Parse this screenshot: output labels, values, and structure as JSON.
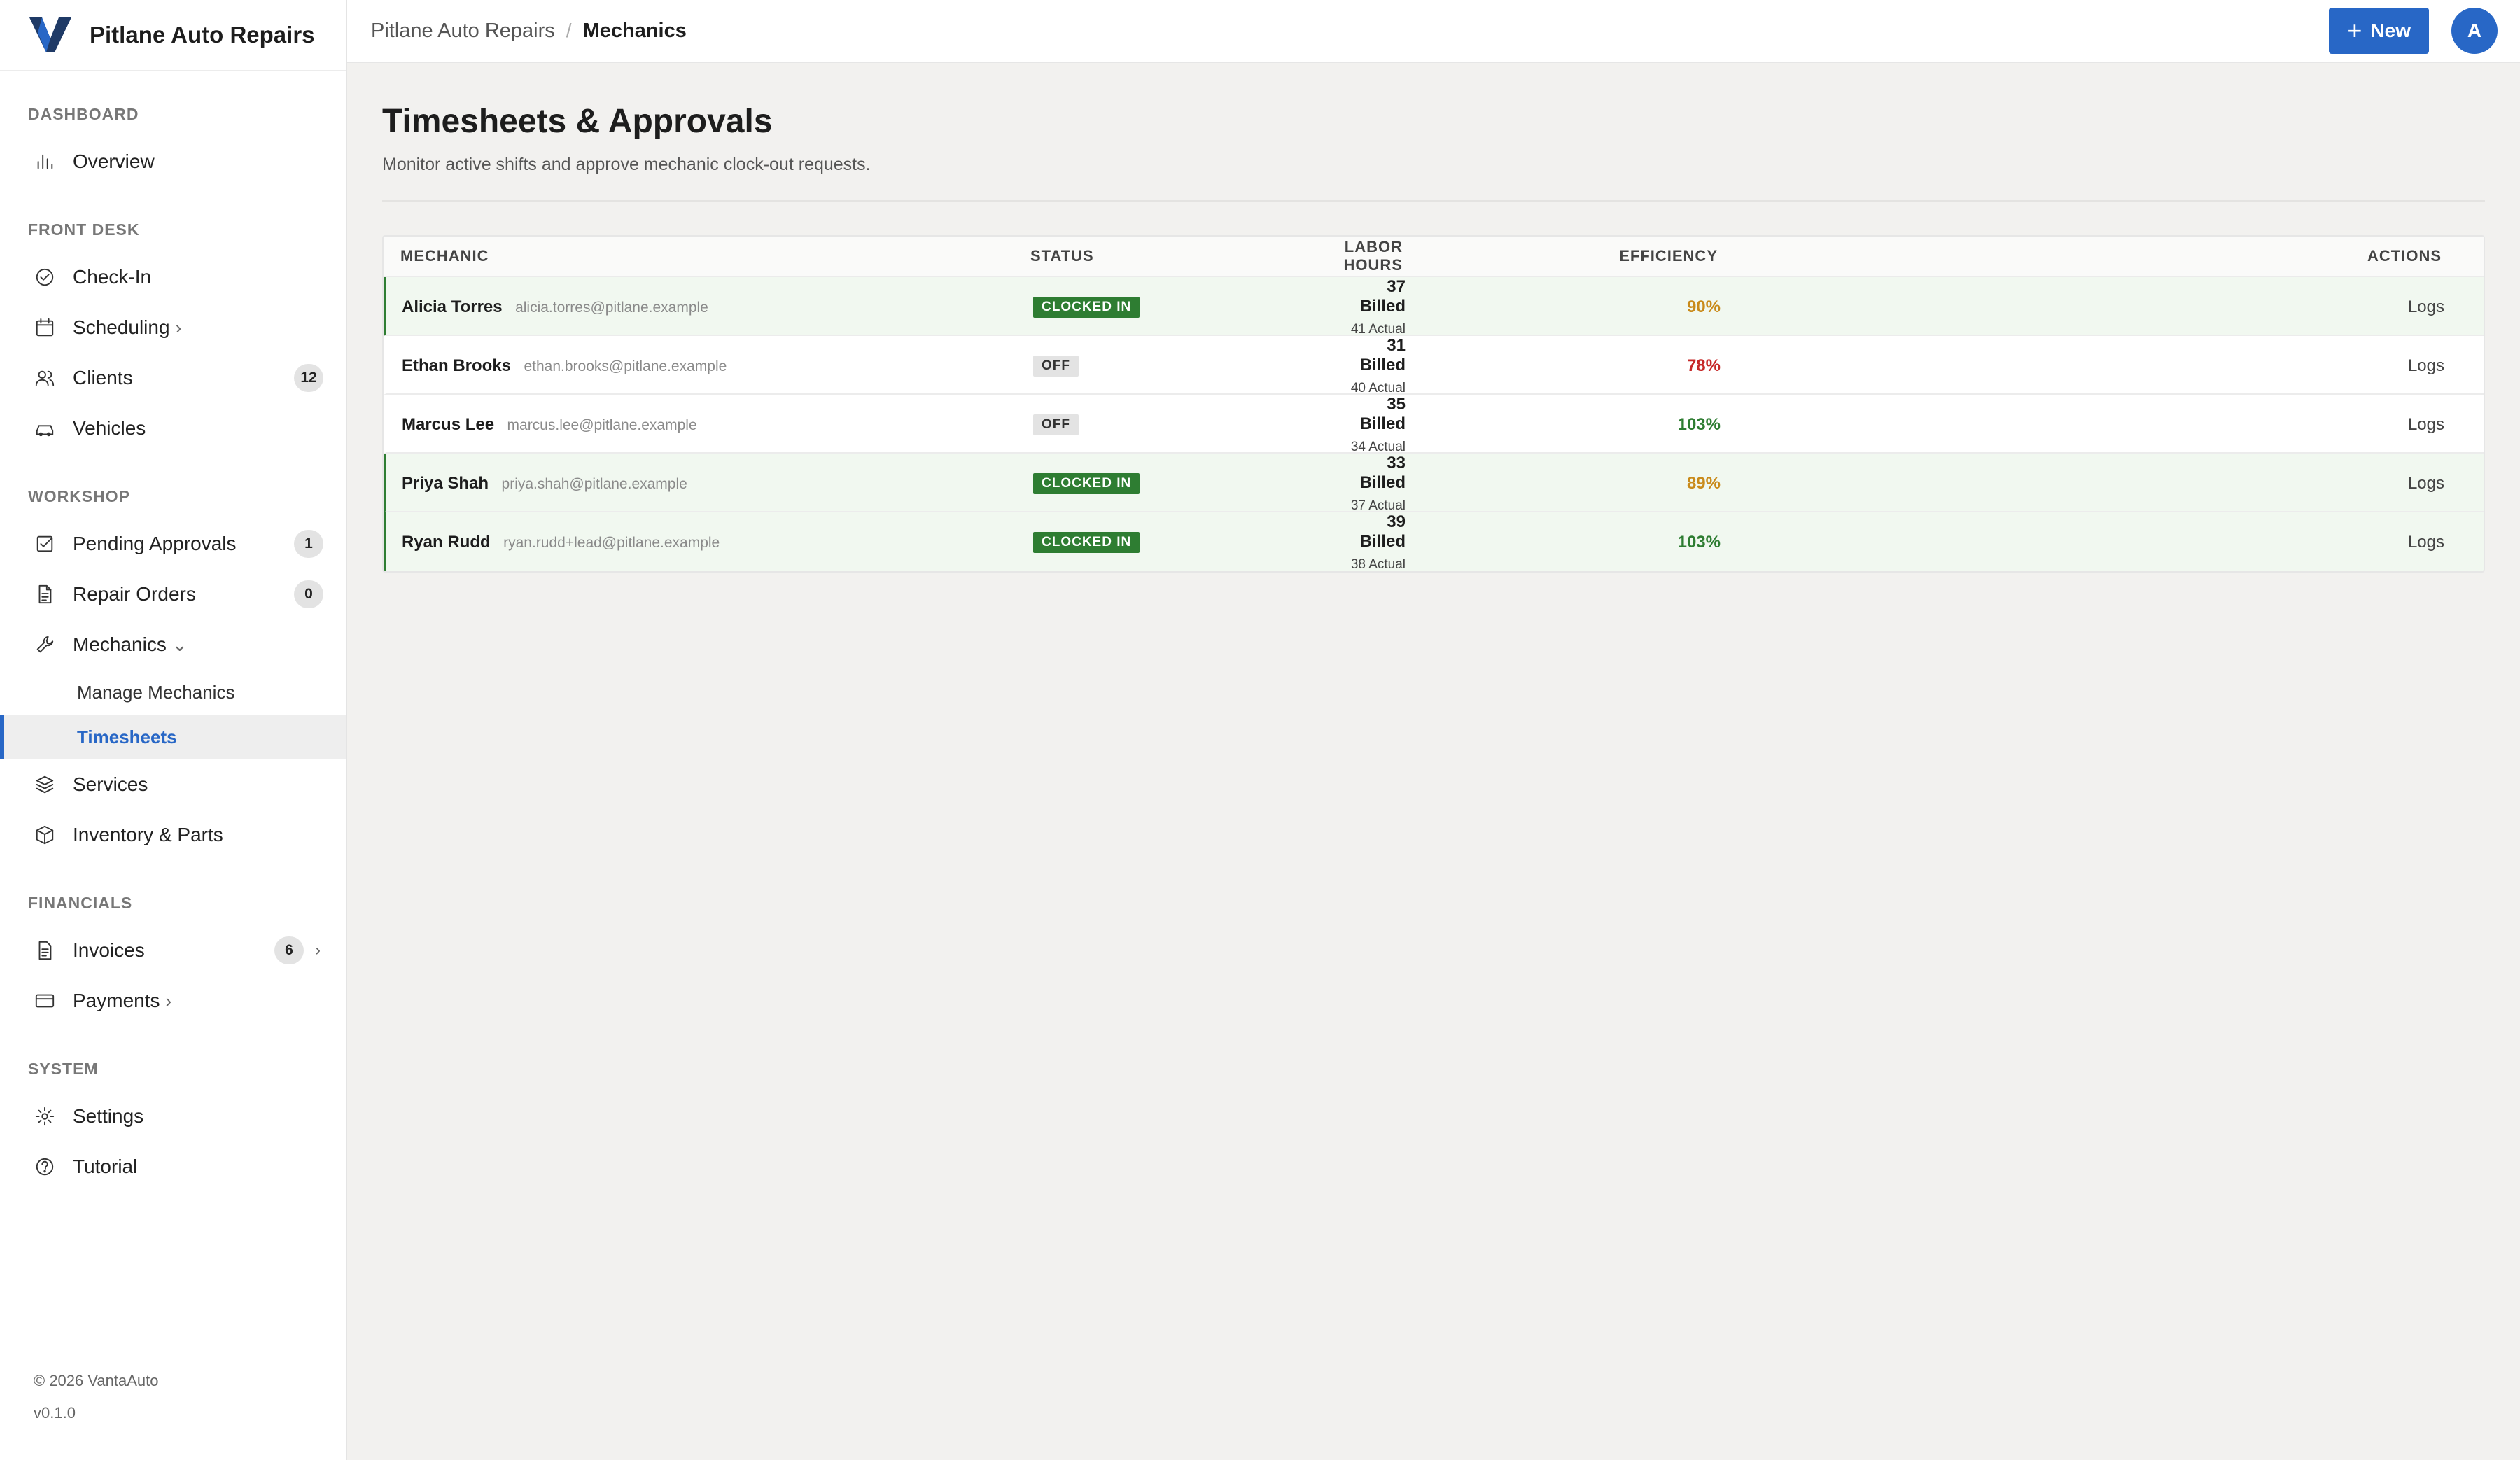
{
  "brand": {
    "name": "Pitlane Auto Repairs",
    "logo_icon": "vanta-v-logo"
  },
  "sidebar": {
    "sections": [
      {
        "title": "DASHBOARD",
        "items": [
          {
            "label": "Overview",
            "icon": "bar-chart-icon"
          }
        ]
      },
      {
        "title": "FRONT DESK",
        "items": [
          {
            "label": "Check-In",
            "icon": "check-circle-icon"
          },
          {
            "label": "Scheduling",
            "icon": "calendar-icon",
            "chevron": "›"
          },
          {
            "label": "Clients",
            "icon": "users-icon",
            "badge": "12"
          },
          {
            "label": "Vehicles",
            "icon": "car-icon"
          }
        ]
      },
      {
        "title": "WORKSHOP",
        "items": [
          {
            "label": "Pending Approvals",
            "icon": "checkbox-icon",
            "badge": "1"
          },
          {
            "label": "Repair Orders",
            "icon": "document-icon",
            "badge": "0"
          },
          {
            "label": "Mechanics",
            "icon": "wrench-icon",
            "chevron": "⌄"
          },
          {
            "sub": "Manage Mechanics"
          },
          {
            "sub": "Timesheets",
            "active": true
          },
          {
            "label": "Services",
            "icon": "layers-icon"
          },
          {
            "label": "Inventory & Parts",
            "icon": "box-icon"
          }
        ]
      },
      {
        "title": "FINANCIALS",
        "items": [
          {
            "label": "Invoices",
            "icon": "invoice-icon",
            "badge": "6",
            "chevron_right": "›"
          },
          {
            "label": "Payments",
            "icon": "credit-card-icon",
            "chevron": "›"
          }
        ]
      },
      {
        "title": "SYSTEM",
        "items": [
          {
            "label": "Settings",
            "icon": "gear-icon"
          },
          {
            "label": "Tutorial",
            "icon": "help-circle-icon"
          }
        ]
      }
    ],
    "footer": {
      "copyright": "© 2026 VantaAuto",
      "version": "v0.1.0"
    }
  },
  "topbar": {
    "breadcrumb_root": "Pitlane Auto Repairs",
    "breadcrumb_sep": "/",
    "breadcrumb_current": "Mechanics",
    "new_button": "New",
    "avatar_initial": "A"
  },
  "page": {
    "title": "Timesheets & Approvals",
    "subtitle": "Monitor active shifts and approve mechanic clock-out requests."
  },
  "table": {
    "headers": {
      "mechanic": "MECHANIC",
      "status": "STATUS",
      "labor_hours": "LABOR HOURS",
      "efficiency": "EFFICIENCY",
      "actions": "ACTIONS"
    },
    "rows": [
      {
        "name": "Alicia Torres",
        "email": "alicia.torres@pitlane.example",
        "status": "CLOCKED IN",
        "active": true,
        "billed": "37 Billed",
        "actual": "41 Actual",
        "efficiency": "90%",
        "eff_color": "#c98a1a",
        "action": "Logs"
      },
      {
        "name": "Ethan Brooks",
        "email": "ethan.brooks@pitlane.example",
        "status": "OFF",
        "active": false,
        "billed": "31 Billed",
        "actual": "40 Actual",
        "efficiency": "78%",
        "eff_color": "#c62828",
        "action": "Logs"
      },
      {
        "name": "Marcus Lee",
        "email": "marcus.lee@pitlane.example",
        "status": "OFF",
        "active": false,
        "billed": "35 Billed",
        "actual": "34 Actual",
        "efficiency": "103%",
        "eff_color": "#2e7d32",
        "action": "Logs"
      },
      {
        "name": "Priya Shah",
        "email": "priya.shah@pitlane.example",
        "status": "CLOCKED IN",
        "active": true,
        "billed": "33 Billed",
        "actual": "37 Actual",
        "efficiency": "89%",
        "eff_color": "#c98a1a",
        "action": "Logs"
      },
      {
        "name": "Ryan Rudd",
        "email": "ryan.rudd+lead@pitlane.example",
        "status": "CLOCKED IN",
        "active": true,
        "billed": "39 Billed",
        "actual": "38 Actual",
        "efficiency": "103%",
        "eff_color": "#2e7d32",
        "action": "Logs"
      }
    ]
  },
  "colors": {
    "accent": "#2867c6",
    "active_row": "#f1f8f0",
    "clocked_in": "#2e7d32"
  }
}
